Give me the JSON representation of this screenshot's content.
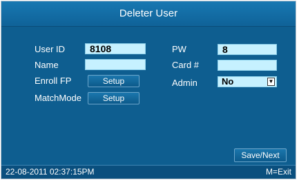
{
  "window": {
    "title": "Deleter User"
  },
  "form": {
    "user_id_label": "User ID",
    "user_id_value": "8108",
    "name_label": "Name",
    "name_value": "",
    "enroll_fp_label": "Enroll FP",
    "enroll_fp_button": "Setup",
    "matchmode_label": "MatchMode",
    "matchmode_button": "Setup",
    "pw_label": "PW",
    "pw_value": "8",
    "card_label": "Card #",
    "card_value": "",
    "admin_label": "Admin",
    "admin_value": "No",
    "admin_arrow_icon": "dropdown-arrow-icon"
  },
  "actions": {
    "save_next_label": "Save/Next"
  },
  "status": {
    "datetime": "22-08-2011 02:37:15PM",
    "exit_hint": "M=Exit"
  },
  "colors": {
    "panel": "#0e5e90",
    "field": "#c6f1ff",
    "button": "#0c5a8b"
  }
}
